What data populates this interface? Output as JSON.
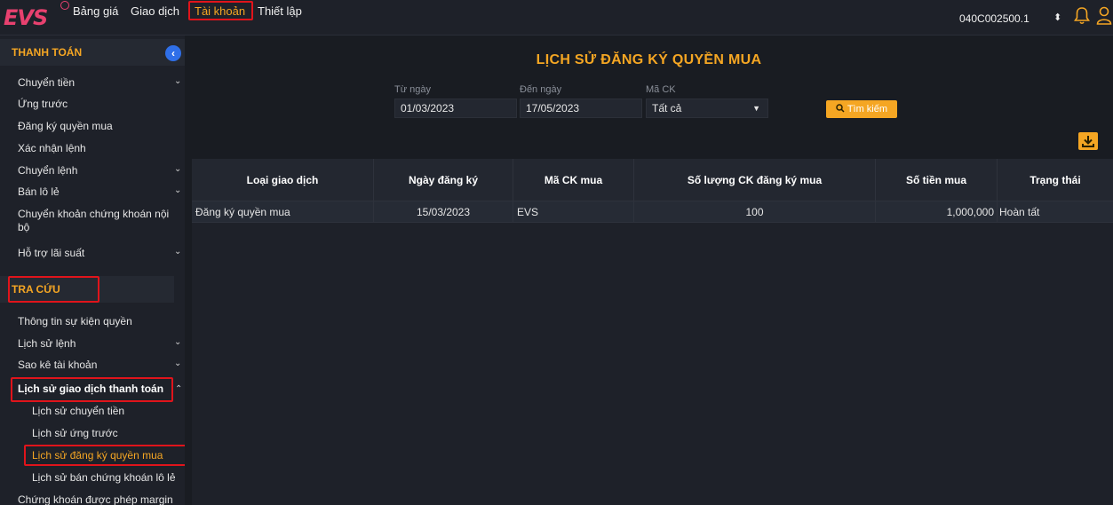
{
  "topbar": {
    "logo": "EVS",
    "nav": [
      "Bảng giá",
      "Giao dịch",
      "Tài khoản",
      "Thiết lập"
    ],
    "active_nav": "Tài khoản",
    "account_id": "040C002500.1",
    "account_arrow": "⬍"
  },
  "sidebar": {
    "section_payment": "THANH TOÁN",
    "collapse_glyph": "‹",
    "payment_items": [
      {
        "label": "Chuyển tiền",
        "chevron": "⌄"
      },
      {
        "label": "Ứng trước",
        "chevron": ""
      },
      {
        "label": "Đăng ký quyền mua",
        "chevron": ""
      },
      {
        "label": "Xác nhận lệnh",
        "chevron": ""
      },
      {
        "label": "Chuyển lệnh",
        "chevron": "⌄"
      },
      {
        "label": "Bán lô lẻ",
        "chevron": "⌄"
      },
      {
        "label": "Chuyển khoản chứng khoán nội bộ",
        "chevron": ""
      },
      {
        "label": "Hỗ trợ lãi suất",
        "chevron": "⌄"
      }
    ],
    "section_lookup": "TRA CỨU",
    "lookup_items": [
      {
        "label": "Thông tin sự kiện quyền",
        "chevron": ""
      },
      {
        "label": "Lịch sử lệnh",
        "chevron": "⌄"
      },
      {
        "label": "Sao kê tài khoản",
        "chevron": "⌄"
      },
      {
        "label": "Lịch sử giao dịch thanh toán",
        "chevron": "⌃"
      }
    ],
    "sub_items": [
      "Lịch sử chuyển tiền",
      "Lịch sử ứng trước",
      "Lịch sử đăng ký quyền mua",
      "Lịch sử bán chứng khoán lô lẻ"
    ],
    "last_item": "Chứng khoán được phép margin"
  },
  "main": {
    "title": "LỊCH SỬ ĐĂNG KÝ QUYỀN MUA",
    "filters": {
      "from_label": "Từ ngày",
      "from_value": "01/03/2023",
      "to_label": "Đến ngày",
      "to_value": "17/05/2023",
      "code_label": "Mã CK",
      "code_value": "Tất cả",
      "search_label": "Tìm kiếm"
    },
    "table": {
      "headers": [
        "Loại giao dịch",
        "Ngày đăng ký",
        "Mã CK mua",
        "Số lượng CK đăng ký mua",
        "Số tiền mua",
        "Trạng thái"
      ],
      "rows": [
        [
          "Đăng ký quyền mua",
          "15/03/2023",
          "EVS",
          "100",
          "1,000,000",
          "Hoàn tất"
        ]
      ]
    }
  },
  "colors": {
    "accent": "#f5a623",
    "highlight_box": "#e0141b",
    "logo": "#e8416f",
    "collapse": "#2f6fe8"
  }
}
